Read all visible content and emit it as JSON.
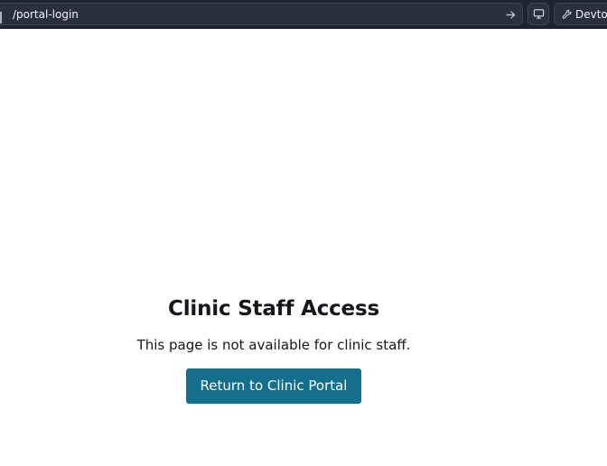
{
  "browser": {
    "url": "/portal-login",
    "go_icon": "arrow-right-icon",
    "device_icon": "monitor-icon",
    "devtools_icon": "wrench-icon",
    "devtools_label": "Devtools"
  },
  "page": {
    "title": "Clinic Staff Access",
    "message": "This page is not available for clinic staff.",
    "button_label": "Return to Clinic Portal"
  },
  "colors": {
    "toolbar_background": "#1e2330",
    "button_background": "#136f8c",
    "text": "#15171c"
  }
}
